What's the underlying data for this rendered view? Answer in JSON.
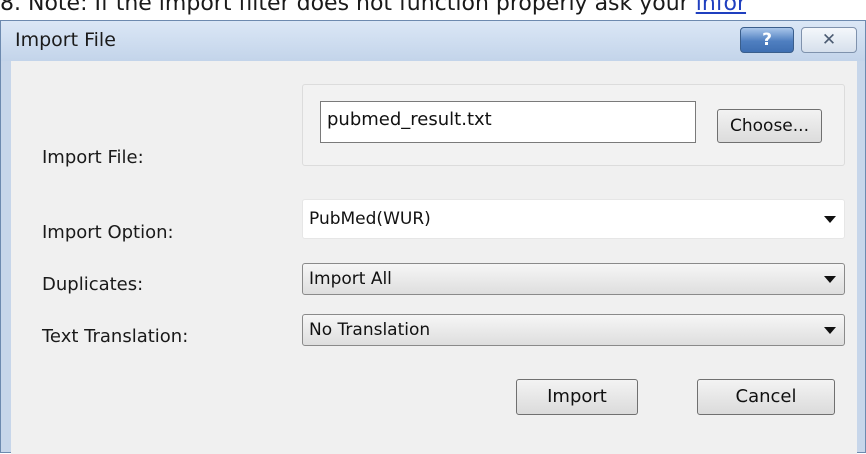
{
  "background_text": {
    "prefix": "8.",
    "text": "Note: If the import filter does not function properly ask your",
    "link": "infor"
  },
  "window": {
    "title": "Import File",
    "help_label": "?",
    "close_label": "✕"
  },
  "form": {
    "import_file": {
      "label": "Import File:",
      "value": "pubmed_result.txt",
      "button": "Choose..."
    },
    "import_option": {
      "label": "Import Option:",
      "value": "PubMed(WUR)"
    },
    "duplicates": {
      "label": "Duplicates:",
      "value": "Import All"
    },
    "text_translation": {
      "label": "Text Translation:",
      "value": "No Translation"
    }
  },
  "buttons": {
    "import": "Import",
    "cancel": "Cancel"
  },
  "colors": {
    "titlebar": "#c7d6ea",
    "client": "#f0f0f0",
    "help_button": "#4f7fc0",
    "link": "#1f3fbf"
  }
}
